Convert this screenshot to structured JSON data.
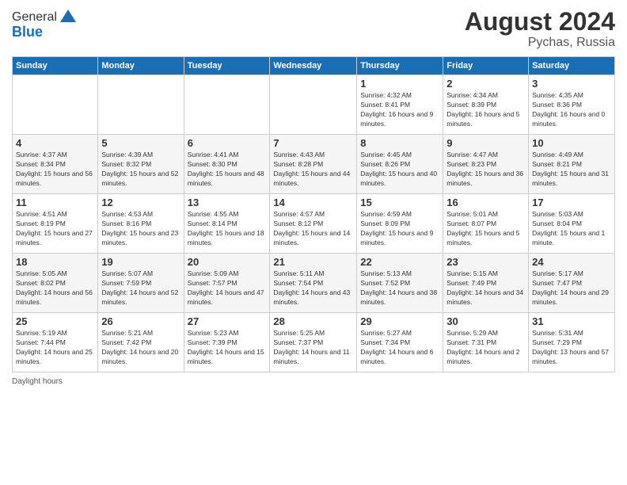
{
  "header": {
    "logo_general": "General",
    "logo_blue": "Blue",
    "month_year": "August 2024",
    "location": "Pychas, Russia"
  },
  "days_of_week": [
    "Sunday",
    "Monday",
    "Tuesday",
    "Wednesday",
    "Thursday",
    "Friday",
    "Saturday"
  ],
  "weeks": [
    [
      {
        "day": "",
        "sunrise": "",
        "sunset": "",
        "daylight": ""
      },
      {
        "day": "",
        "sunrise": "",
        "sunset": "",
        "daylight": ""
      },
      {
        "day": "",
        "sunrise": "",
        "sunset": "",
        "daylight": ""
      },
      {
        "day": "",
        "sunrise": "",
        "sunset": "",
        "daylight": ""
      },
      {
        "day": "1",
        "sunrise": "Sunrise: 4:32 AM",
        "sunset": "Sunset: 8:41 PM",
        "daylight": "Daylight: 16 hours and 9 minutes."
      },
      {
        "day": "2",
        "sunrise": "Sunrise: 4:34 AM",
        "sunset": "Sunset: 8:39 PM",
        "daylight": "Daylight: 16 hours and 5 minutes."
      },
      {
        "day": "3",
        "sunrise": "Sunrise: 4:35 AM",
        "sunset": "Sunset: 8:36 PM",
        "daylight": "Daylight: 16 hours and 0 minutes."
      }
    ],
    [
      {
        "day": "4",
        "sunrise": "Sunrise: 4:37 AM",
        "sunset": "Sunset: 8:34 PM",
        "daylight": "Daylight: 15 hours and 56 minutes."
      },
      {
        "day": "5",
        "sunrise": "Sunrise: 4:39 AM",
        "sunset": "Sunset: 8:32 PM",
        "daylight": "Daylight: 15 hours and 52 minutes."
      },
      {
        "day": "6",
        "sunrise": "Sunrise: 4:41 AM",
        "sunset": "Sunset: 8:30 PM",
        "daylight": "Daylight: 15 hours and 48 minutes."
      },
      {
        "day": "7",
        "sunrise": "Sunrise: 4:43 AM",
        "sunset": "Sunset: 8:28 PM",
        "daylight": "Daylight: 15 hours and 44 minutes."
      },
      {
        "day": "8",
        "sunrise": "Sunrise: 4:45 AM",
        "sunset": "Sunset: 8:26 PM",
        "daylight": "Daylight: 15 hours and 40 minutes."
      },
      {
        "day": "9",
        "sunrise": "Sunrise: 4:47 AM",
        "sunset": "Sunset: 8:23 PM",
        "daylight": "Daylight: 15 hours and 36 minutes."
      },
      {
        "day": "10",
        "sunrise": "Sunrise: 4:49 AM",
        "sunset": "Sunset: 8:21 PM",
        "daylight": "Daylight: 15 hours and 31 minutes."
      }
    ],
    [
      {
        "day": "11",
        "sunrise": "Sunrise: 4:51 AM",
        "sunset": "Sunset: 8:19 PM",
        "daylight": "Daylight: 15 hours and 27 minutes."
      },
      {
        "day": "12",
        "sunrise": "Sunrise: 4:53 AM",
        "sunset": "Sunset: 8:16 PM",
        "daylight": "Daylight: 15 hours and 23 minutes."
      },
      {
        "day": "13",
        "sunrise": "Sunrise: 4:55 AM",
        "sunset": "Sunset: 8:14 PM",
        "daylight": "Daylight: 15 hours and 18 minutes."
      },
      {
        "day": "14",
        "sunrise": "Sunrise: 4:57 AM",
        "sunset": "Sunset: 8:12 PM",
        "daylight": "Daylight: 15 hours and 14 minutes."
      },
      {
        "day": "15",
        "sunrise": "Sunrise: 4:59 AM",
        "sunset": "Sunset: 8:09 PM",
        "daylight": "Daylight: 15 hours and 9 minutes."
      },
      {
        "day": "16",
        "sunrise": "Sunrise: 5:01 AM",
        "sunset": "Sunset: 8:07 PM",
        "daylight": "Daylight: 15 hours and 5 minutes."
      },
      {
        "day": "17",
        "sunrise": "Sunrise: 5:03 AM",
        "sunset": "Sunset: 8:04 PM",
        "daylight": "Daylight: 15 hours and 1 minute."
      }
    ],
    [
      {
        "day": "18",
        "sunrise": "Sunrise: 5:05 AM",
        "sunset": "Sunset: 8:02 PM",
        "daylight": "Daylight: 14 hours and 56 minutes."
      },
      {
        "day": "19",
        "sunrise": "Sunrise: 5:07 AM",
        "sunset": "Sunset: 7:59 PM",
        "daylight": "Daylight: 14 hours and 52 minutes."
      },
      {
        "day": "20",
        "sunrise": "Sunrise: 5:09 AM",
        "sunset": "Sunset: 7:57 PM",
        "daylight": "Daylight: 14 hours and 47 minutes."
      },
      {
        "day": "21",
        "sunrise": "Sunrise: 5:11 AM",
        "sunset": "Sunset: 7:54 PM",
        "daylight": "Daylight: 14 hours and 43 minutes."
      },
      {
        "day": "22",
        "sunrise": "Sunrise: 5:13 AM",
        "sunset": "Sunset: 7:52 PM",
        "daylight": "Daylight: 14 hours and 38 minutes."
      },
      {
        "day": "23",
        "sunrise": "Sunrise: 5:15 AM",
        "sunset": "Sunset: 7:49 PM",
        "daylight": "Daylight: 14 hours and 34 minutes."
      },
      {
        "day": "24",
        "sunrise": "Sunrise: 5:17 AM",
        "sunset": "Sunset: 7:47 PM",
        "daylight": "Daylight: 14 hours and 29 minutes."
      }
    ],
    [
      {
        "day": "25",
        "sunrise": "Sunrise: 5:19 AM",
        "sunset": "Sunset: 7:44 PM",
        "daylight": "Daylight: 14 hours and 25 minutes."
      },
      {
        "day": "26",
        "sunrise": "Sunrise: 5:21 AM",
        "sunset": "Sunset: 7:42 PM",
        "daylight": "Daylight: 14 hours and 20 minutes."
      },
      {
        "day": "27",
        "sunrise": "Sunrise: 5:23 AM",
        "sunset": "Sunset: 7:39 PM",
        "daylight": "Daylight: 14 hours and 15 minutes."
      },
      {
        "day": "28",
        "sunrise": "Sunrise: 5:25 AM",
        "sunset": "Sunset: 7:37 PM",
        "daylight": "Daylight: 14 hours and 11 minutes."
      },
      {
        "day": "29",
        "sunrise": "Sunrise: 5:27 AM",
        "sunset": "Sunset: 7:34 PM",
        "daylight": "Daylight: 14 hours and 6 minutes."
      },
      {
        "day": "30",
        "sunrise": "Sunrise: 5:29 AM",
        "sunset": "Sunset: 7:31 PM",
        "daylight": "Daylight: 14 hours and 2 minutes."
      },
      {
        "day": "31",
        "sunrise": "Sunrise: 5:31 AM",
        "sunset": "Sunset: 7:29 PM",
        "daylight": "Daylight: 13 hours and 57 minutes."
      }
    ]
  ],
  "footer": {
    "label": "Daylight hours"
  }
}
